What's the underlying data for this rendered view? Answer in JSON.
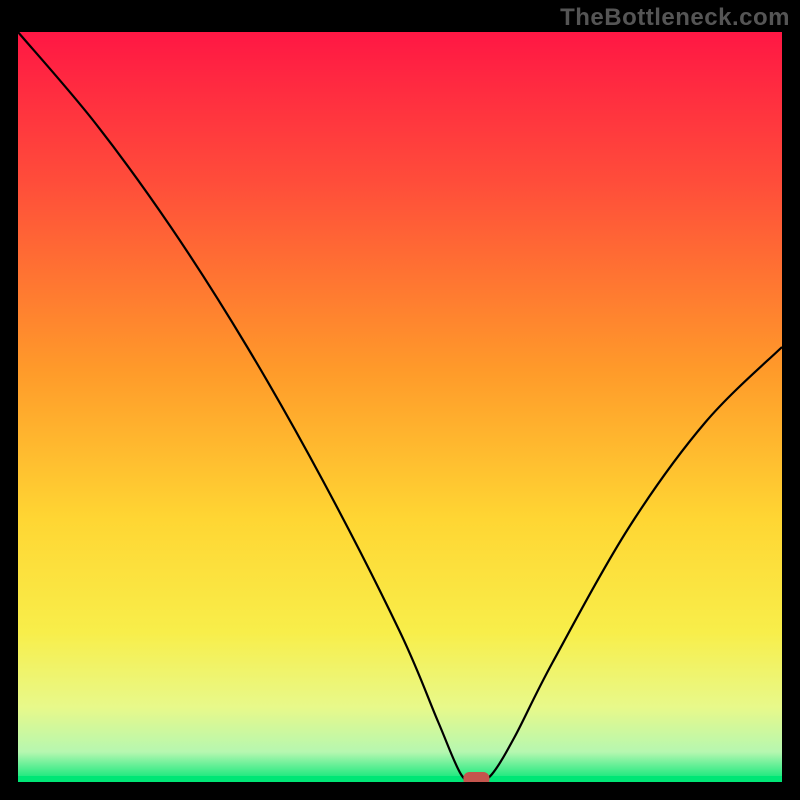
{
  "watermark": "TheBottleneck.com",
  "chart_data": {
    "type": "line",
    "title": "",
    "xlabel": "",
    "ylabel": "",
    "xlim": [
      0,
      100
    ],
    "ylim": [
      0,
      100
    ],
    "x": [
      0,
      10,
      20,
      30,
      40,
      50,
      55,
      58,
      60,
      62,
      65,
      70,
      80,
      90,
      100
    ],
    "values": [
      100,
      88,
      74,
      58,
      40,
      20,
      8,
      1,
      0,
      1,
      6,
      16,
      34,
      48,
      58
    ],
    "minimum_x": 60,
    "baseline_y": 0,
    "gradient_stops": [
      {
        "offset": 0.0,
        "color": "#ff1744"
      },
      {
        "offset": 0.2,
        "color": "#ff4d3a"
      },
      {
        "offset": 0.45,
        "color": "#ff9a2a"
      },
      {
        "offset": 0.65,
        "color": "#ffd633"
      },
      {
        "offset": 0.8,
        "color": "#f8ee4a"
      },
      {
        "offset": 0.9,
        "color": "#e8f98a"
      },
      {
        "offset": 0.96,
        "color": "#b6f7b0"
      },
      {
        "offset": 1.0,
        "color": "#00e676"
      }
    ]
  }
}
